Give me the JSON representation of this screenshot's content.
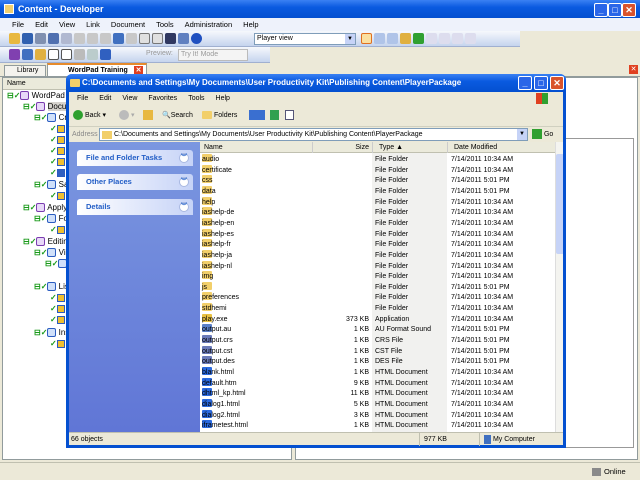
{
  "app": {
    "title": "Content - Developer",
    "menu": [
      "File",
      "Edit",
      "View",
      "Link",
      "Document",
      "Tools",
      "Administration",
      "Help"
    ],
    "view_select": "Player view",
    "preview_label": "Preview:",
    "preview_mode": "Try It! Mode",
    "tabs": [
      {
        "label": "Library"
      },
      {
        "label": "WordPad Training"
      }
    ],
    "tree_header": "Name",
    "tree": [
      "WordPad T",
      "Docum",
      "Cre",
      "Sav",
      "Applyin",
      "For",
      "Editing",
      "Vie",
      "List",
      "Ins"
    ],
    "status": "Online"
  },
  "explorer": {
    "title": "C:\\Documents and Settings\\My Documents\\User Productivity Kit\\Publishing Content\\PlayerPackage",
    "menu": [
      "File",
      "Edit",
      "View",
      "Favorites",
      "Tools",
      "Help"
    ],
    "toolbar": {
      "back": "Back",
      "search": "Search",
      "folders": "Folders"
    },
    "address_label": "Address",
    "address": "C:\\Documents and Settings\\My Documents\\User Productivity Kit\\Publishing Content\\PlayerPackage",
    "go": "Go",
    "panels": [
      "File and Folder Tasks",
      "Other Places",
      "Details"
    ],
    "columns": [
      "Name",
      "Size",
      "Type",
      "Date Modified"
    ],
    "files": [
      {
        "name": "audio",
        "size": "",
        "type": "File Folder",
        "date": "7/14/2011 10:34 AM",
        "icon": "folder"
      },
      {
        "name": "certificate",
        "size": "",
        "type": "File Folder",
        "date": "7/14/2011 10:34 AM",
        "icon": "folder"
      },
      {
        "name": "css",
        "size": "",
        "type": "File Folder",
        "date": "7/14/2011 5:01 PM",
        "icon": "folder"
      },
      {
        "name": "data",
        "size": "",
        "type": "File Folder",
        "date": "7/14/2011 5:01 PM",
        "icon": "folder"
      },
      {
        "name": "help",
        "size": "",
        "type": "File Folder",
        "date": "7/14/2011 10:34 AM",
        "icon": "folder"
      },
      {
        "name": "iashelp-de",
        "size": "",
        "type": "File Folder",
        "date": "7/14/2011 10:34 AM",
        "icon": "folder"
      },
      {
        "name": "iashelp-en",
        "size": "",
        "type": "File Folder",
        "date": "7/14/2011 10:34 AM",
        "icon": "folder"
      },
      {
        "name": "iashelp-es",
        "size": "",
        "type": "File Folder",
        "date": "7/14/2011 10:34 AM",
        "icon": "folder"
      },
      {
        "name": "iashelp-fr",
        "size": "",
        "type": "File Folder",
        "date": "7/14/2011 10:34 AM",
        "icon": "folder"
      },
      {
        "name": "iashelp-ja",
        "size": "",
        "type": "File Folder",
        "date": "7/14/2011 10:34 AM",
        "icon": "folder"
      },
      {
        "name": "iashelp-nl",
        "size": "",
        "type": "File Folder",
        "date": "7/14/2011 10:34 AM",
        "icon": "folder"
      },
      {
        "name": "img",
        "size": "",
        "type": "File Folder",
        "date": "7/14/2011 10:34 AM",
        "icon": "folder"
      },
      {
        "name": "js",
        "size": "",
        "type": "File Folder",
        "date": "7/14/2011 5:01 PM",
        "icon": "folder"
      },
      {
        "name": "preferences",
        "size": "",
        "type": "File Folder",
        "date": "7/14/2011 10:34 AM",
        "icon": "folder"
      },
      {
        "name": "stdhemi",
        "size": "",
        "type": "File Folder",
        "date": "7/14/2011 10:34 AM",
        "icon": "folder"
      },
      {
        "name": "play.exe",
        "size": "373 KB",
        "type": "Application",
        "date": "7/14/2011 10:34 AM",
        "icon": "exe"
      },
      {
        "name": "output.au",
        "size": "1 KB",
        "type": "AU Format Sound",
        "date": "7/14/2011 5:01 PM",
        "icon": "sound"
      },
      {
        "name": "output.crs",
        "size": "1 KB",
        "type": "CRS File",
        "date": "7/14/2011 5:01 PM",
        "icon": "file"
      },
      {
        "name": "output.cst",
        "size": "1 KB",
        "type": "CST File",
        "date": "7/14/2011 5:01 PM",
        "icon": "file"
      },
      {
        "name": "output.des",
        "size": "1 KB",
        "type": "DES File",
        "date": "7/14/2011 5:01 PM",
        "icon": "file"
      },
      {
        "name": "blank.html",
        "size": "1 KB",
        "type": "HTML Document",
        "date": "7/14/2011 10:34 AM",
        "icon": "html"
      },
      {
        "name": "default.htm",
        "size": "9 KB",
        "type": "HTML Document",
        "date": "7/14/2011 10:34 AM",
        "icon": "html"
      },
      {
        "name": "dhtml_kp.html",
        "size": "11 KB",
        "type": "HTML Document",
        "date": "7/14/2011 10:34 AM",
        "icon": "html"
      },
      {
        "name": "dialog1.html",
        "size": "5 KB",
        "type": "HTML Document",
        "date": "7/14/2011 10:34 AM",
        "icon": "html"
      },
      {
        "name": "dialog2.html",
        "size": "3 KB",
        "type": "HTML Document",
        "date": "7/14/2011 10:34 AM",
        "icon": "html"
      },
      {
        "name": "iframetest.html",
        "size": "1 KB",
        "type": "HTML Document",
        "date": "7/14/2011 10:34 AM",
        "icon": "html"
      }
    ],
    "status": {
      "objects": "66 objects",
      "size": "977 KB",
      "location": "My Computer"
    }
  },
  "colors": {
    "xp_blue": "#0450d0",
    "task_pane": "#6a85de",
    "close_red": "#d9532c"
  }
}
